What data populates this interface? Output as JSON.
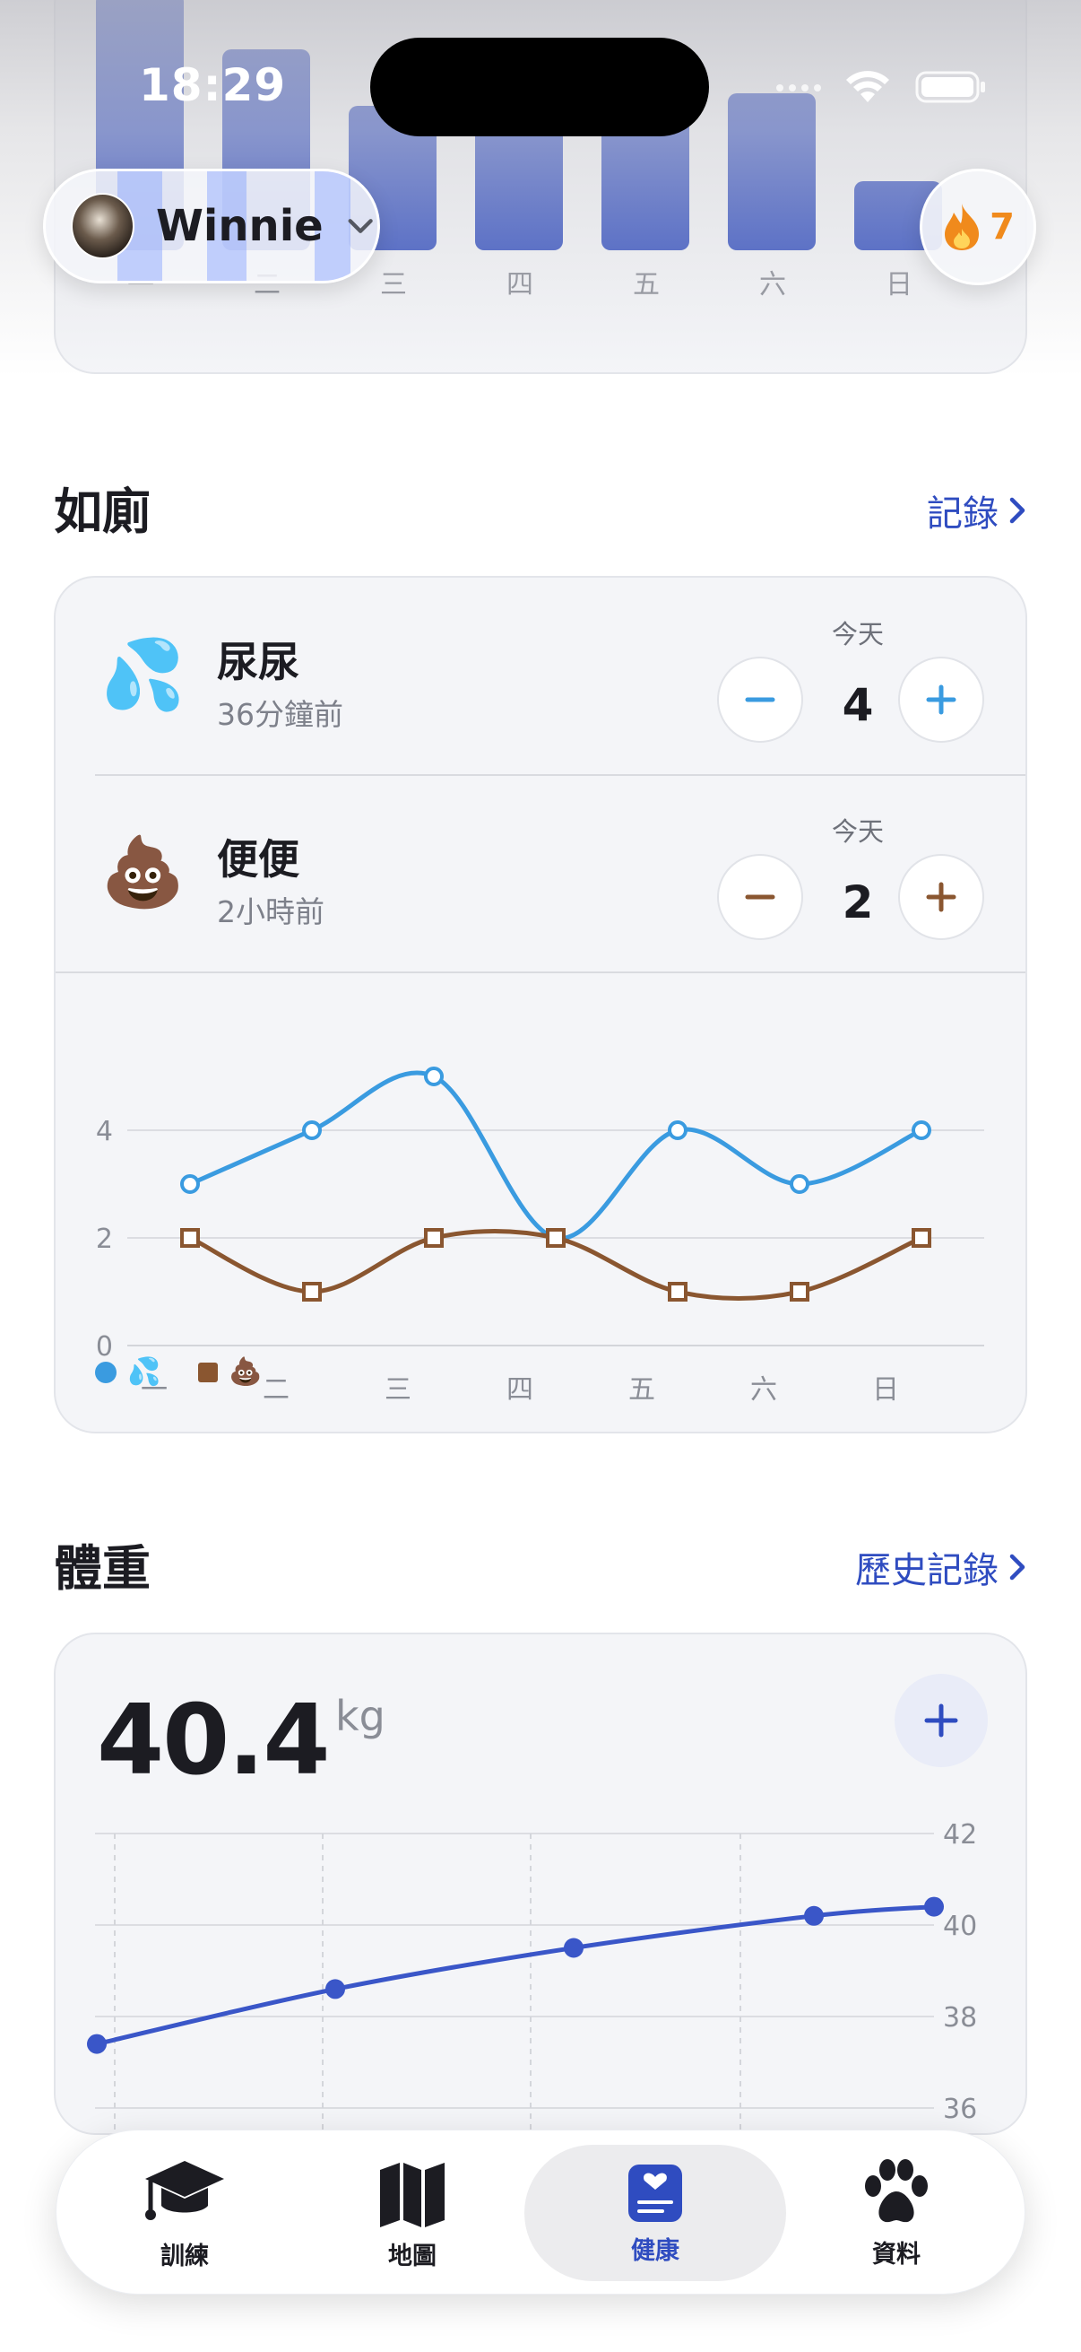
{
  "status": {
    "time": "18:29"
  },
  "pet": {
    "name": "Winnie"
  },
  "streak": {
    "count": "7"
  },
  "activity": {
    "days": [
      "一",
      "二",
      "三",
      "四",
      "五",
      "六",
      "日"
    ]
  },
  "potty": {
    "title": "如廁",
    "link": "記錄",
    "pee": {
      "label": "尿尿",
      "emoji": "💦",
      "subtitle": "36分鐘前",
      "today_label": "今天",
      "count": "4"
    },
    "poop": {
      "label": "便便",
      "emoji": "💩",
      "subtitle": "2小時前",
      "today_label": "今天",
      "count": "2"
    },
    "legend": {
      "pee": "💦",
      "poop": "💩"
    }
  },
  "weight": {
    "title": "體重",
    "link": "歷史記錄",
    "value": "40.4",
    "unit": "kg"
  },
  "tabs": [
    {
      "label": "訓練",
      "icon": "graduation-cap-icon"
    },
    {
      "label": "地圖",
      "icon": "map-icon"
    },
    {
      "label": "健康",
      "icon": "health-icon"
    },
    {
      "label": "資料",
      "icon": "paw-icon"
    }
  ],
  "colors": {
    "accent": "#2f4cc0",
    "pee": "#3a9be0",
    "poop": "#8a5630",
    "streak": "#f08a1c"
  },
  "chart_data": [
    {
      "type": "bar",
      "categories": [
        "一",
        "二",
        "三",
        "四",
        "五",
        "六",
        "日"
      ],
      "values": [
        4.1,
        3.2,
        2.3,
        2.2,
        2.3,
        2.5,
        1.1
      ],
      "note_visible": "top of chart scrolled out of view"
    },
    {
      "type": "line",
      "categories": [
        "一",
        "二",
        "三",
        "四",
        "五",
        "六",
        "日"
      ],
      "yticks": [
        0,
        2,
        4
      ],
      "ylim": [
        0,
        5.5
      ],
      "series": [
        {
          "name": "💦",
          "color": "#3a9be0",
          "marker": "circle",
          "values": [
            3,
            4,
            5,
            2,
            4,
            3,
            4
          ]
        },
        {
          "name": "💩",
          "color": "#8a5630",
          "marker": "square",
          "values": [
            2,
            1,
            2,
            2,
            1,
            1,
            2
          ]
        }
      ]
    },
    {
      "type": "line",
      "yticks": [
        36,
        38,
        40,
        42
      ],
      "ylim": [
        36,
        42
      ],
      "series": [
        {
          "color": "#3a56c8",
          "values": [
            37.4,
            38.6,
            39.5,
            40.2,
            40.4
          ]
        }
      ]
    }
  ]
}
